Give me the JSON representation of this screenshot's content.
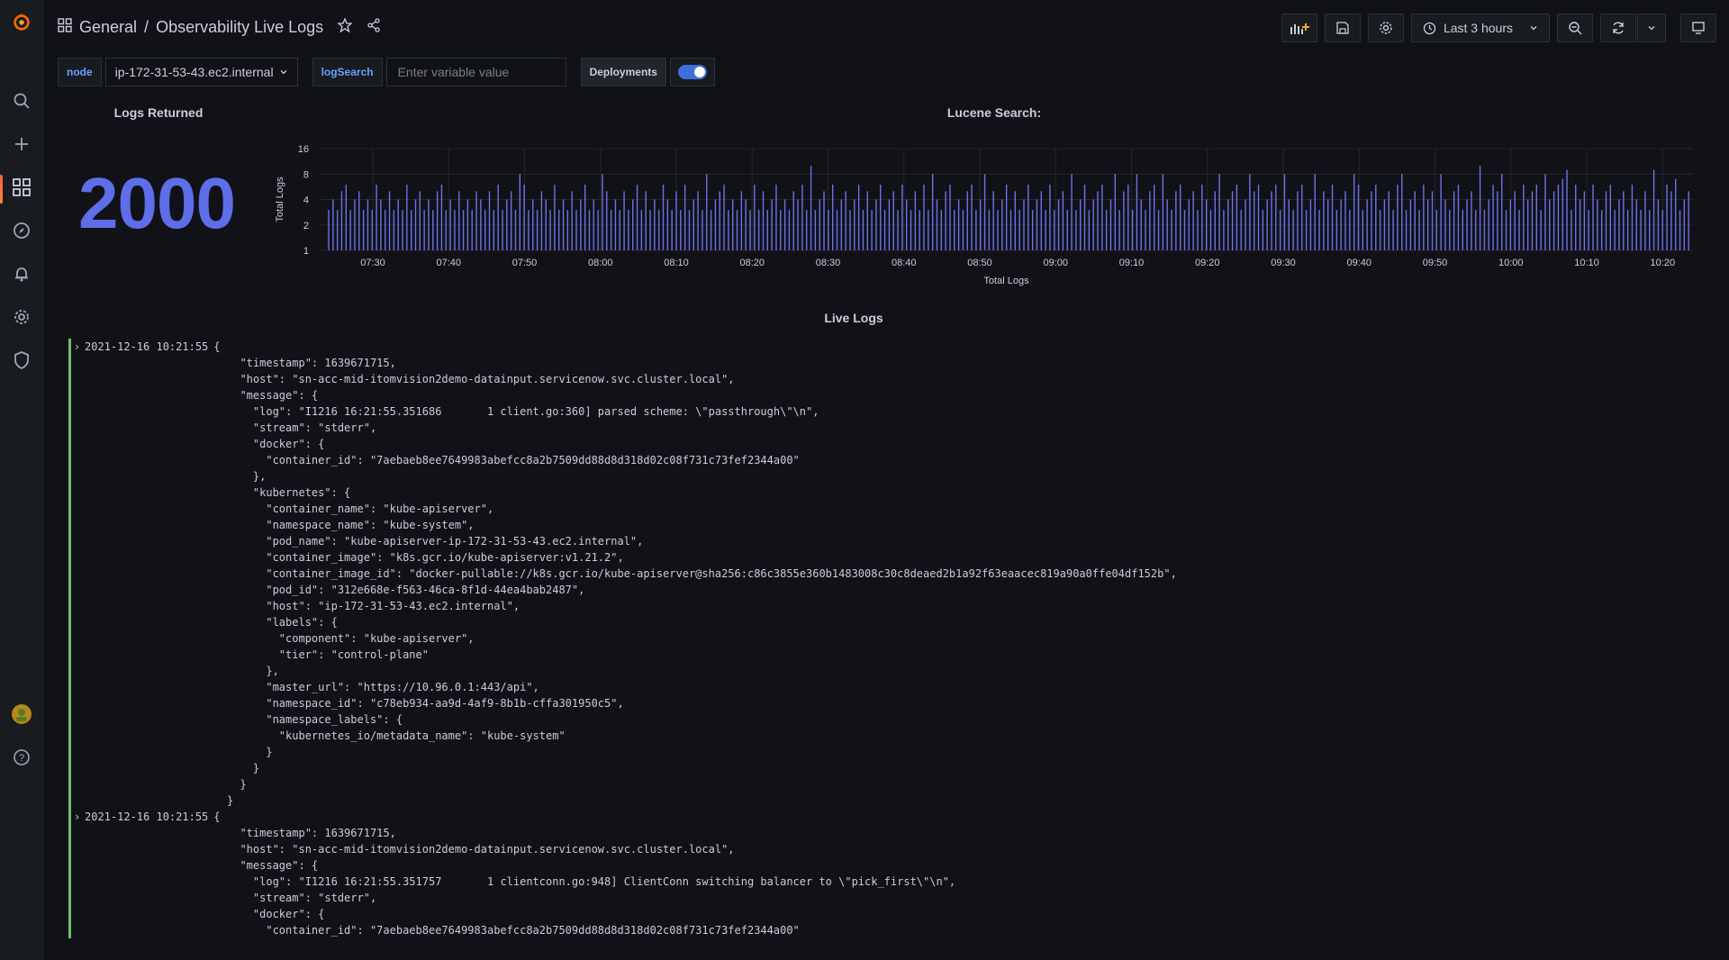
{
  "header": {
    "breadcrumb_parent": "General",
    "breadcrumb_sep": "/",
    "title": "Observability Live Logs",
    "time_range": "Last 3 hours"
  },
  "variables": {
    "node_label": "node",
    "node_value": "ip-172-31-53-43.ec2.internal",
    "logsearch_label": "logSearch",
    "logsearch_placeholder": "Enter variable value",
    "deployments_label": "Deployments",
    "deployments_enabled": true
  },
  "stat_panel": {
    "title": "Logs Returned",
    "value": "2000"
  },
  "chart_panel": {
    "title": "Lucene Search:"
  },
  "chart_data": {
    "type": "bar",
    "xlabel": "Total Logs",
    "ylabel": "Total Logs",
    "y_scale": "log2",
    "ylim": [
      1,
      16
    ],
    "y_ticks": [
      "16",
      "8",
      "4",
      "2",
      "1"
    ],
    "x_ticks": [
      "07:30",
      "07:40",
      "07:50",
      "08:00",
      "08:10",
      "08:20",
      "08:30",
      "08:40",
      "08:50",
      "09:00",
      "09:10",
      "09:20",
      "09:30",
      "09:40",
      "09:50",
      "10:00",
      "10:10",
      "10:20"
    ],
    "x_range": [
      "07:23",
      "10:24"
    ],
    "values": [
      3,
      4,
      3,
      5,
      6,
      3,
      4,
      5,
      3,
      4,
      3,
      6,
      4,
      3,
      5,
      3,
      4,
      3,
      6,
      3,
      4,
      5,
      3,
      4,
      3,
      5,
      6,
      3,
      4,
      3,
      5,
      3,
      4,
      3,
      5,
      4,
      3,
      5,
      3,
      6,
      3,
      4,
      5,
      3,
      8,
      6,
      3,
      4,
      3,
      5,
      4,
      3,
      6,
      3,
      4,
      3,
      5,
      3,
      4,
      6,
      3,
      4,
      3,
      8,
      5,
      3,
      4,
      3,
      5,
      3,
      4,
      6,
      3,
      5,
      3,
      4,
      3,
      6,
      4,
      3,
      5,
      3,
      6,
      3,
      4,
      5,
      3,
      8,
      3,
      4,
      5,
      6,
      3,
      4,
      3,
      5,
      4,
      3,
      6,
      3,
      5,
      3,
      4,
      6,
      3,
      4,
      3,
      5,
      4,
      6,
      3,
      10,
      3,
      4,
      5,
      3,
      6,
      3,
      4,
      5,
      3,
      4,
      6,
      3,
      5,
      3,
      4,
      6,
      3,
      4,
      5,
      3,
      6,
      4,
      3,
      5,
      3,
      6,
      3,
      8,
      4,
      3,
      5,
      6,
      3,
      4,
      3,
      5,
      6,
      3,
      4,
      8,
      3,
      5,
      3,
      4,
      6,
      3,
      5,
      3,
      4,
      6,
      3,
      4,
      5,
      3,
      6,
      3,
      4,
      5,
      3,
      8,
      3,
      4,
      6,
      3,
      4,
      5,
      6,
      3,
      4,
      8,
      3,
      5,
      6,
      3,
      8,
      4,
      3,
      5,
      6,
      3,
      8,
      4,
      3,
      5,
      6,
      3,
      4,
      5,
      3,
      6,
      4,
      3,
      5,
      8,
      3,
      4,
      5,
      6,
      3,
      4,
      8,
      5,
      6,
      3,
      4,
      5,
      6,
      3,
      8,
      4,
      3,
      5,
      6,
      3,
      4,
      8,
      3,
      5,
      4,
      6,
      3,
      4,
      5,
      3,
      8,
      6,
      3,
      4,
      5,
      6,
      3,
      4,
      5,
      3,
      6,
      8,
      3,
      4,
      5,
      3,
      6,
      4,
      5,
      3,
      8,
      4,
      3,
      5,
      6,
      3,
      4,
      5,
      3,
      10,
      3,
      4,
      6,
      5,
      8,
      3,
      4,
      5,
      3,
      6,
      4,
      5,
      6,
      3,
      8,
      4,
      5,
      6,
      7,
      9,
      3,
      6,
      4,
      5,
      3,
      6,
      4,
      3,
      5,
      6,
      3,
      4,
      5,
      3,
      6,
      4,
      3,
      5,
      3,
      9,
      4,
      3,
      6,
      5,
      7,
      3,
      4,
      5
    ]
  },
  "logs_panel": {
    "title": "Live Logs",
    "entries": [
      {
        "ts": "2021-12-16 10:21:55",
        "body": "{\n  \"timestamp\": 1639671715,\n  \"host\": \"sn-acc-mid-itomvision2demo-datainput.servicenow.svc.cluster.local\",\n  \"message\": {\n    \"log\": \"I1216 16:21:55.351686       1 client.go:360] parsed scheme: \\\"passthrough\\\"\\n\",\n    \"stream\": \"stderr\",\n    \"docker\": {\n      \"container_id\": \"7aebaeb8ee7649983abefcc8a2b7509dd88d8d318d02c08f731c73fef2344a00\"\n    },\n    \"kubernetes\": {\n      \"container_name\": \"kube-apiserver\",\n      \"namespace_name\": \"kube-system\",\n      \"pod_name\": \"kube-apiserver-ip-172-31-53-43.ec2.internal\",\n      \"container_image\": \"k8s.gcr.io/kube-apiserver:v1.21.2\",\n      \"container_image_id\": \"docker-pullable://k8s.gcr.io/kube-apiserver@sha256:c86c3855e360b1483008c30c8deaed2b1a92f63eaacec819a90a0ffe04df152b\",\n      \"pod_id\": \"312e668e-f563-46ca-8f1d-44ea4bab2487\",\n      \"host\": \"ip-172-31-53-43.ec2.internal\",\n      \"labels\": {\n        \"component\": \"kube-apiserver\",\n        \"tier\": \"control-plane\"\n      },\n      \"master_url\": \"https://10.96.0.1:443/api\",\n      \"namespace_id\": \"c78eb934-aa9d-4af9-8b1b-cffa301950c5\",\n      \"namespace_labels\": {\n        \"kubernetes_io/metadata_name\": \"kube-system\"\n      }\n    }\n  }\n}"
      },
      {
        "ts": "2021-12-16 10:21:55",
        "body": "{\n  \"timestamp\": 1639671715,\n  \"host\": \"sn-acc-mid-itomvision2demo-datainput.servicenow.svc.cluster.local\",\n  \"message\": {\n    \"log\": \"I1216 16:21:55.351757       1 clientconn.go:948] ClientConn switching balancer to \\\"pick_first\\\"\\n\",\n    \"stream\": \"stderr\",\n    \"docker\": {\n      \"container_id\": \"7aebaeb8ee7649983abefcc8a2b7509dd88d8d318d02c08f731c73fef2344a00\""
      }
    ]
  }
}
